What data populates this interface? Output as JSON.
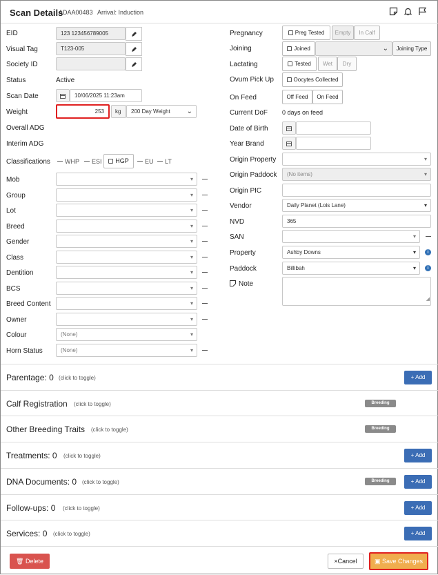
{
  "header": {
    "title": "Scan Details",
    "id": "ADAA00483",
    "arrival": "Arrival: Induction"
  },
  "left": {
    "eid": {
      "label": "EID",
      "value": "123 123456789005"
    },
    "visual_tag": {
      "label": "Visual Tag",
      "value": "T123-005"
    },
    "society_id": {
      "label": "Society ID",
      "value": ""
    },
    "status": {
      "label": "Status",
      "value": "Active"
    },
    "scan_date": {
      "label": "Scan Date",
      "value": "10/06/2025 11:23am"
    },
    "weight": {
      "label": "Weight",
      "value": "253",
      "unit": "kg",
      "type": "200 Day Weight"
    },
    "overall_adg": {
      "label": "Overall ADG"
    },
    "interim_adg": {
      "label": "Interim ADG"
    },
    "classifications": {
      "label": "Classifications",
      "items": [
        "WHP",
        "ESI",
        "HGP",
        "EU",
        "LT"
      ]
    },
    "mob": {
      "label": "Mob"
    },
    "group": {
      "label": "Group"
    },
    "lot": {
      "label": "Lot"
    },
    "breed": {
      "label": "Breed"
    },
    "gender": {
      "label": "Gender"
    },
    "class": {
      "label": "Class"
    },
    "dentition": {
      "label": "Dentition"
    },
    "bcs": {
      "label": "BCS"
    },
    "breed_content": {
      "label": "Breed Content"
    },
    "owner": {
      "label": "Owner"
    },
    "colour": {
      "label": "Colour",
      "value": "(None)"
    },
    "horn_status": {
      "label": "Horn Status",
      "value": "(None)"
    }
  },
  "right": {
    "pregnancy": {
      "label": "Pregnancy",
      "check": "Preg Tested",
      "opt1": "Empty",
      "opt2": "In Calf"
    },
    "joining": {
      "label": "Joining",
      "check": "Joined",
      "type_btn": "Joining Type"
    },
    "lactating": {
      "label": "Lactating",
      "check": "Tested",
      "opt1": "Wet",
      "opt2": "Dry"
    },
    "ovum": {
      "label": "Ovum Pick Up",
      "check": "Oocytes Collected"
    },
    "on_feed": {
      "label": "On Feed",
      "opt1": "Off Feed",
      "opt2": "On Feed"
    },
    "current_dof": {
      "label": "Current DoF",
      "value": "0 days on feed"
    },
    "dob": {
      "label": "Date of Birth"
    },
    "year_brand": {
      "label": "Year Brand"
    },
    "origin_property": {
      "label": "Origin Property"
    },
    "origin_paddock": {
      "label": "Origin Paddock",
      "value": "(No items)"
    },
    "origin_pic": {
      "label": "Origin PIC"
    },
    "vendor": {
      "label": "Vendor",
      "value": "Daily Planet (Lois Lane)"
    },
    "nvd": {
      "label": "NVD",
      "value": "365"
    },
    "san": {
      "label": "SAN"
    },
    "property": {
      "label": "Property",
      "value": "Ashby Downs"
    },
    "paddock": {
      "label": "Paddock",
      "value": "Billibah"
    },
    "note": {
      "label": "Note"
    }
  },
  "sections": [
    {
      "title": "Parentage:",
      "count": "0",
      "hint": "(click to toggle)",
      "add": "+ Add"
    },
    {
      "title": "Calf Registration",
      "hint": "(click to toggle)",
      "badge": "Breeding"
    },
    {
      "title": "Other Breeding Traits",
      "hint": "(click to toggle)",
      "badge": "Breeding"
    },
    {
      "title": "Treatments:",
      "count": "0",
      "hint": "(click to toggle)",
      "add": "+ Add"
    },
    {
      "title": "DNA Documents:",
      "count": "0",
      "hint": "(click to toggle)",
      "badge": "Breeding",
      "add": "+ Add"
    },
    {
      "title": "Follow-ups:",
      "count": "0",
      "hint": "(click to toggle)",
      "add": "+ Add"
    },
    {
      "title": "Services:",
      "count": "0",
      "hint": "(click to toggle)",
      "add": "+ Add"
    }
  ],
  "footer": {
    "delete": "Delete",
    "cancel": "Cancel",
    "save": "Save Changes"
  },
  "colors": {
    "primary": "#3b6db5",
    "danger": "#d9534f",
    "warning": "#f0ad4e",
    "highlight": "#e02020"
  }
}
